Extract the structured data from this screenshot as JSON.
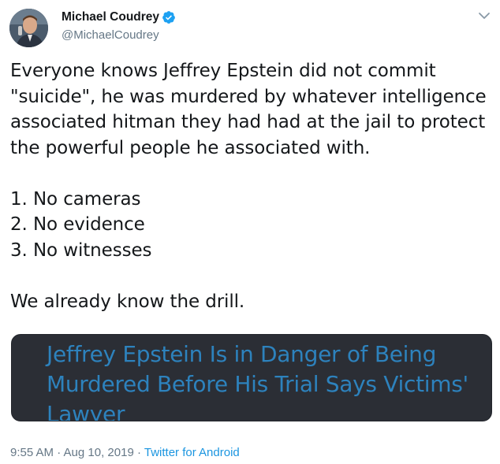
{
  "author": {
    "display_name": "Michael Coudrey",
    "handle": "@MichaelCoudrey",
    "verified_color": "#1da1f2"
  },
  "tweet": {
    "paragraphs": [
      "Everyone knows Jeffrey Epstein did not commit \"suicide\", he was murdered by whatever intelligence associated hitman they had had at the jail to protect the powerful people he associated with.",
      "1. No cameras\n2. No evidence\n3. No witnesses",
      "We already know the drill."
    ]
  },
  "card": {
    "title": "Jeffrey Epstein Is in Danger of Being Murdered Before His Trial Says Victims' Lawyer"
  },
  "meta": {
    "timestamp": "9:55 AM · Aug 10, 2019",
    "separator": " · ",
    "source": "Twitter for Android"
  },
  "icons": {
    "verified": "verified-badge-icon",
    "caret": "chevron-down-icon"
  }
}
